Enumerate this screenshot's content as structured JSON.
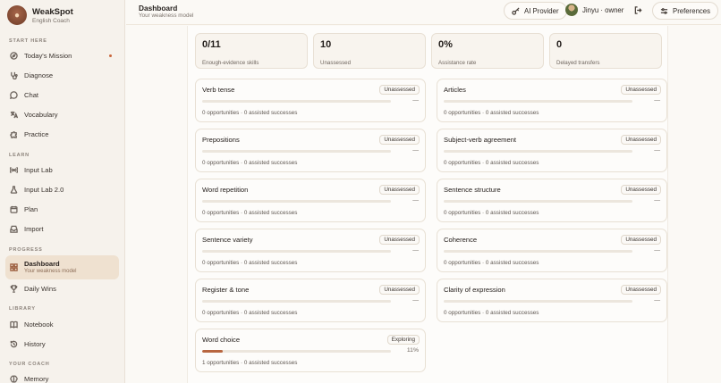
{
  "brand": {
    "name": "WeakSpot",
    "sub": "English Coach"
  },
  "sidebar": {
    "sections": {
      "start": "START HERE",
      "learn": "LEARN",
      "progress": "PROGRESS",
      "library": "LIBRARY",
      "coach": "YOUR COACH"
    },
    "items": [
      {
        "label": "Today's Mission",
        "icon": "compass-icon"
      },
      {
        "label": "Diagnose",
        "icon": "stethoscope-icon"
      },
      {
        "label": "Chat",
        "icon": "chat-icon"
      },
      {
        "label": "Vocabulary",
        "icon": "translate-icon"
      },
      {
        "label": "Practice",
        "icon": "puzzle-icon"
      },
      {
        "label": "Input Lab",
        "icon": "radio-icon"
      },
      {
        "label": "Input Lab 2.0",
        "icon": "flask-icon"
      },
      {
        "label": "Plan",
        "icon": "calendar-icon"
      },
      {
        "label": "Import",
        "icon": "inbox-icon"
      },
      {
        "label": "Dashboard",
        "sub": "Your weakness model",
        "icon": "grid-icon"
      },
      {
        "label": "Daily Wins",
        "icon": "trophy-icon"
      },
      {
        "label": "Notebook",
        "icon": "book-icon"
      },
      {
        "label": "History",
        "icon": "history-icon"
      },
      {
        "label": "Memory",
        "icon": "brain-icon"
      }
    ]
  },
  "header": {
    "title": "Dashboard",
    "subtitle": "Your weakness model",
    "ai_provider": "AI Provider",
    "user": "Jinyu · owner",
    "preferences": "Preferences"
  },
  "stats": [
    {
      "value": "0/11",
      "label": "Enough-evidence skills"
    },
    {
      "value": "10",
      "label": "Unassessed"
    },
    {
      "value": "0%",
      "label": "Assistance rate"
    },
    {
      "value": "0",
      "label": "Delayed transfers"
    }
  ],
  "skills": [
    {
      "name": "Verb tense",
      "status": "Unassessed",
      "progress": 0,
      "pct": "—",
      "meta": "0 opportunities · 0 assisted successes"
    },
    {
      "name": "Articles",
      "status": "Unassessed",
      "progress": 0,
      "pct": "—",
      "meta": "0 opportunities · 0 assisted successes"
    },
    {
      "name": "Prepositions",
      "status": "Unassessed",
      "progress": 0,
      "pct": "—",
      "meta": "0 opportunities · 0 assisted successes"
    },
    {
      "name": "Subject-verb agreement",
      "status": "Unassessed",
      "progress": 0,
      "pct": "—",
      "meta": "0 opportunities · 0 assisted successes"
    },
    {
      "name": "Word repetition",
      "status": "Unassessed",
      "progress": 0,
      "pct": "—",
      "meta": "0 opportunities · 0 assisted successes"
    },
    {
      "name": "Sentence structure",
      "status": "Unassessed",
      "progress": 0,
      "pct": "—",
      "meta": "0 opportunities · 0 assisted successes"
    },
    {
      "name": "Sentence variety",
      "status": "Unassessed",
      "progress": 0,
      "pct": "—",
      "meta": "0 opportunities · 0 assisted successes"
    },
    {
      "name": "Coherence",
      "status": "Unassessed",
      "progress": 0,
      "pct": "—",
      "meta": "0 opportunities · 0 assisted successes"
    },
    {
      "name": "Register & tone",
      "status": "Unassessed",
      "progress": 0,
      "pct": "—",
      "meta": "0 opportunities · 0 assisted successes"
    },
    {
      "name": "Clarity of expression",
      "status": "Unassessed",
      "progress": 0,
      "pct": "—",
      "meta": "0 opportunities · 0 assisted successes"
    },
    {
      "name": "Word choice",
      "status": "Exploring",
      "progress": 11,
      "pct": "11%",
      "meta": "1 opportunities · 0 assisted successes"
    }
  ],
  "colors": {
    "accent": "#b86640",
    "active_bg": "#efe1d0",
    "dot": "#c9663b"
  }
}
